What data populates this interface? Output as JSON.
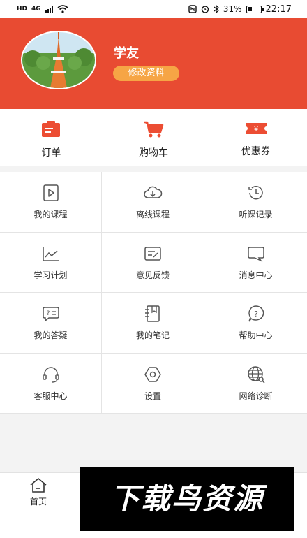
{
  "status_bar": {
    "left_label": "HD",
    "network": "4G",
    "battery_percent": "31%",
    "time": "22:17"
  },
  "profile": {
    "username": "学友",
    "edit_label": "修改资料"
  },
  "quick_actions": [
    {
      "label": "订单",
      "icon": "order-icon"
    },
    {
      "label": "购物车",
      "icon": "cart-icon"
    },
    {
      "label": "优惠券",
      "icon": "coupon-icon"
    }
  ],
  "grid": [
    {
      "label": "我的课程",
      "icon": "course-play-icon"
    },
    {
      "label": "离线课程",
      "icon": "cloud-download-icon"
    },
    {
      "label": "听课记录",
      "icon": "history-icon"
    },
    {
      "label": "学习计划",
      "icon": "chart-line-icon"
    },
    {
      "label": "意见反馈",
      "icon": "feedback-icon"
    },
    {
      "label": "消息中心",
      "icon": "message-icon"
    },
    {
      "label": "我的答疑",
      "icon": "qa-icon"
    },
    {
      "label": "我的笔记",
      "icon": "notebook-icon"
    },
    {
      "label": "帮助中心",
      "icon": "help-icon"
    },
    {
      "label": "客服中心",
      "icon": "headset-icon"
    },
    {
      "label": "设置",
      "icon": "settings-icon"
    },
    {
      "label": "网络诊断",
      "icon": "globe-search-icon"
    }
  ],
  "bottom_nav": {
    "home_label": "首页"
  },
  "watermark": {
    "text": "下载鸟资源"
  },
  "colors": {
    "brand_red": "#e84b32",
    "edit_orange": "#f6a545",
    "icon_red": "#ec4d33",
    "icon_gray": "#555555"
  }
}
